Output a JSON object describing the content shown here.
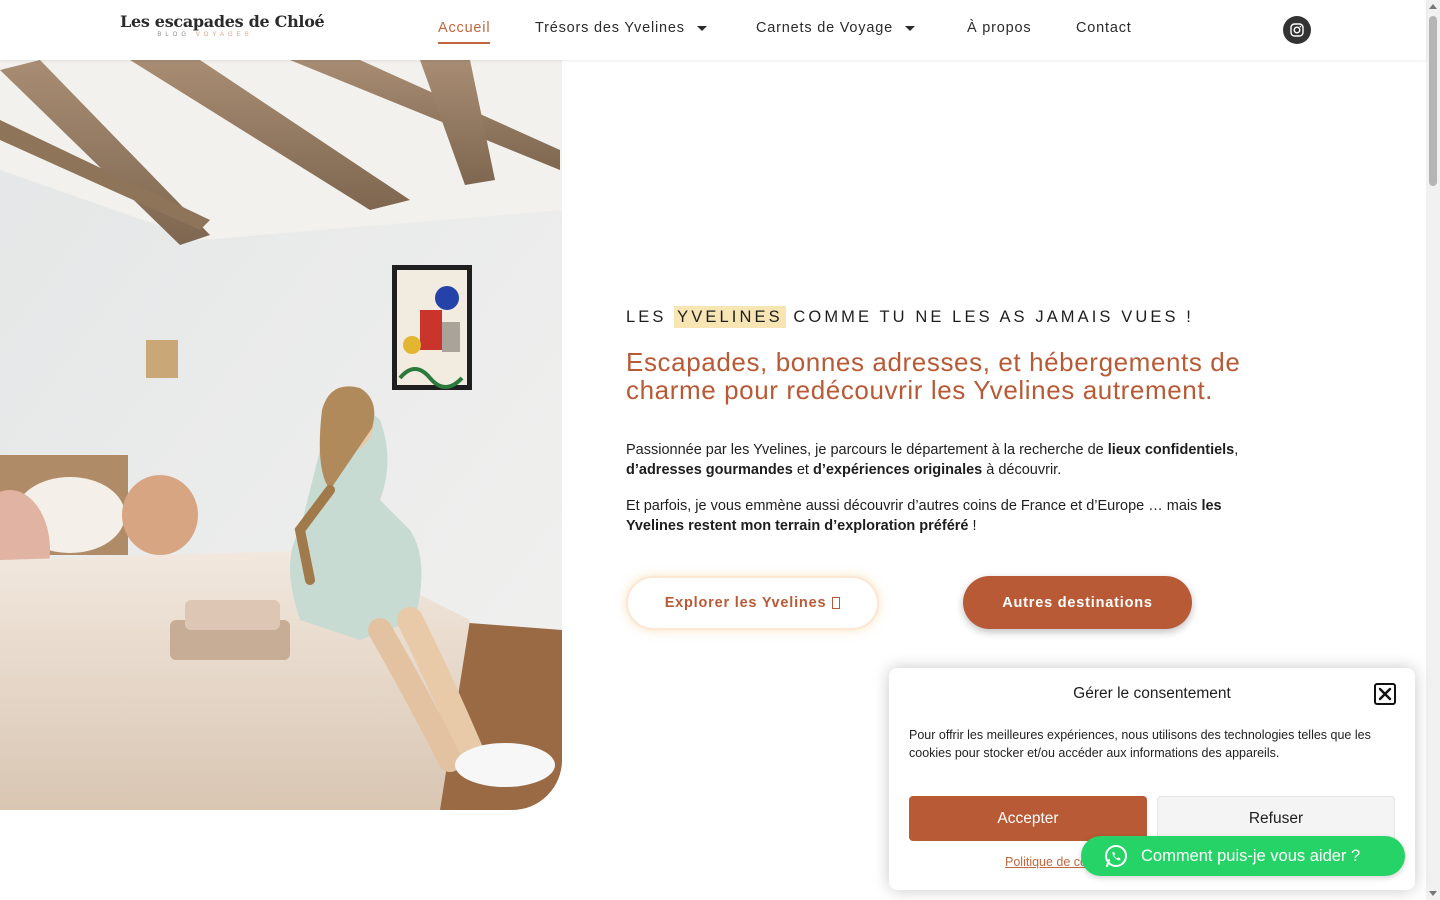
{
  "header": {
    "logo_title": "Les escapades de Chloé",
    "logo_sub_1": "BLOG",
    "logo_sub_2": "VOYAGES",
    "nav": [
      {
        "label": "Accueil",
        "active": true
      },
      {
        "label": "Trésors des Yvelines",
        "dropdown": true
      },
      {
        "label": "Carnets de Voyage",
        "dropdown": true
      },
      {
        "label": "À propos"
      },
      {
        "label": "Contact"
      }
    ],
    "social_icon": "instagram-icon"
  },
  "hero": {
    "kicker_before": "LES ",
    "kicker_highlight": "YVELINES",
    "kicker_after": " COMME TU NE LES AS JAMAIS VUES !",
    "headline": "Escapades, bonnes adresses, et hébergements de charme pour redécouvrir les Yvelines autrement.",
    "p1": {
      "t1": "Passionnée par les Yvelines, je parcours le département à la recherche de ",
      "b1": "lieux confidentiels",
      "t2": ", ",
      "b2": "d’adresses gourmandes",
      "t3": " et ",
      "b3": "d’expériences originales",
      "t4": " à découvrir."
    },
    "p2": {
      "t1": "Et parfois, je vous emmène aussi découvrir d’autres coins de France et d’Europe … mais ",
      "b1": "les Yvelines restent mon terrain d’exploration préféré",
      "t2": " !"
    },
    "btn_explore": "Explorer les Yvelines",
    "btn_other": "Autres destinations",
    "image_alt": "bedroom-photo"
  },
  "cookie": {
    "title": "Gérer le consentement",
    "text": "Pour offrir les meilleures expériences, nous utilisons des technologies telles que les cookies pour stocker et/ou accéder aux informations des appareils.",
    "accept": "Accepter",
    "refuse": "Refuser",
    "policy": "Politique de cookies"
  },
  "whatsapp": {
    "label": "Comment puis-je vous aider ?"
  },
  "colors": {
    "accent": "#b85a35",
    "highlight": "#f7e5b3",
    "whatsapp": "#25d366"
  }
}
